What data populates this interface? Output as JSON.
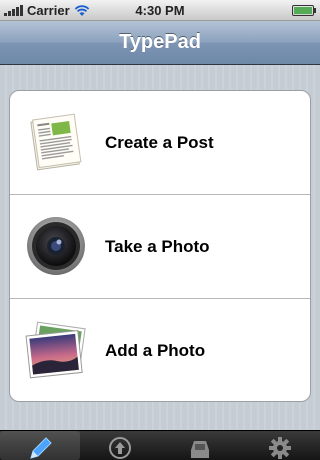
{
  "status_bar": {
    "carrier": "Carrier",
    "time": "4:30 PM",
    "wifi_icon": "wifi-icon",
    "battery_level": 1.0
  },
  "navbar": {
    "title": "TypePad"
  },
  "menu": {
    "items": [
      {
        "label": "Create a Post",
        "icon": "document-icon"
      },
      {
        "label": "Take a Photo",
        "icon": "camera-lens-icon"
      },
      {
        "label": "Add a Photo",
        "icon": "photo-icon"
      }
    ]
  },
  "tabbar": {
    "tabs": [
      {
        "icon": "pencil-icon",
        "selected": true
      },
      {
        "icon": "upload-icon",
        "selected": false
      },
      {
        "icon": "inbox-icon",
        "selected": false
      },
      {
        "icon": "gear-icon",
        "selected": false
      }
    ]
  },
  "colors": {
    "navbar_top": "#b4c3d6",
    "navbar_bottom": "#6e88a9",
    "background": "#c5ccd4",
    "tabbar": "#151515"
  }
}
